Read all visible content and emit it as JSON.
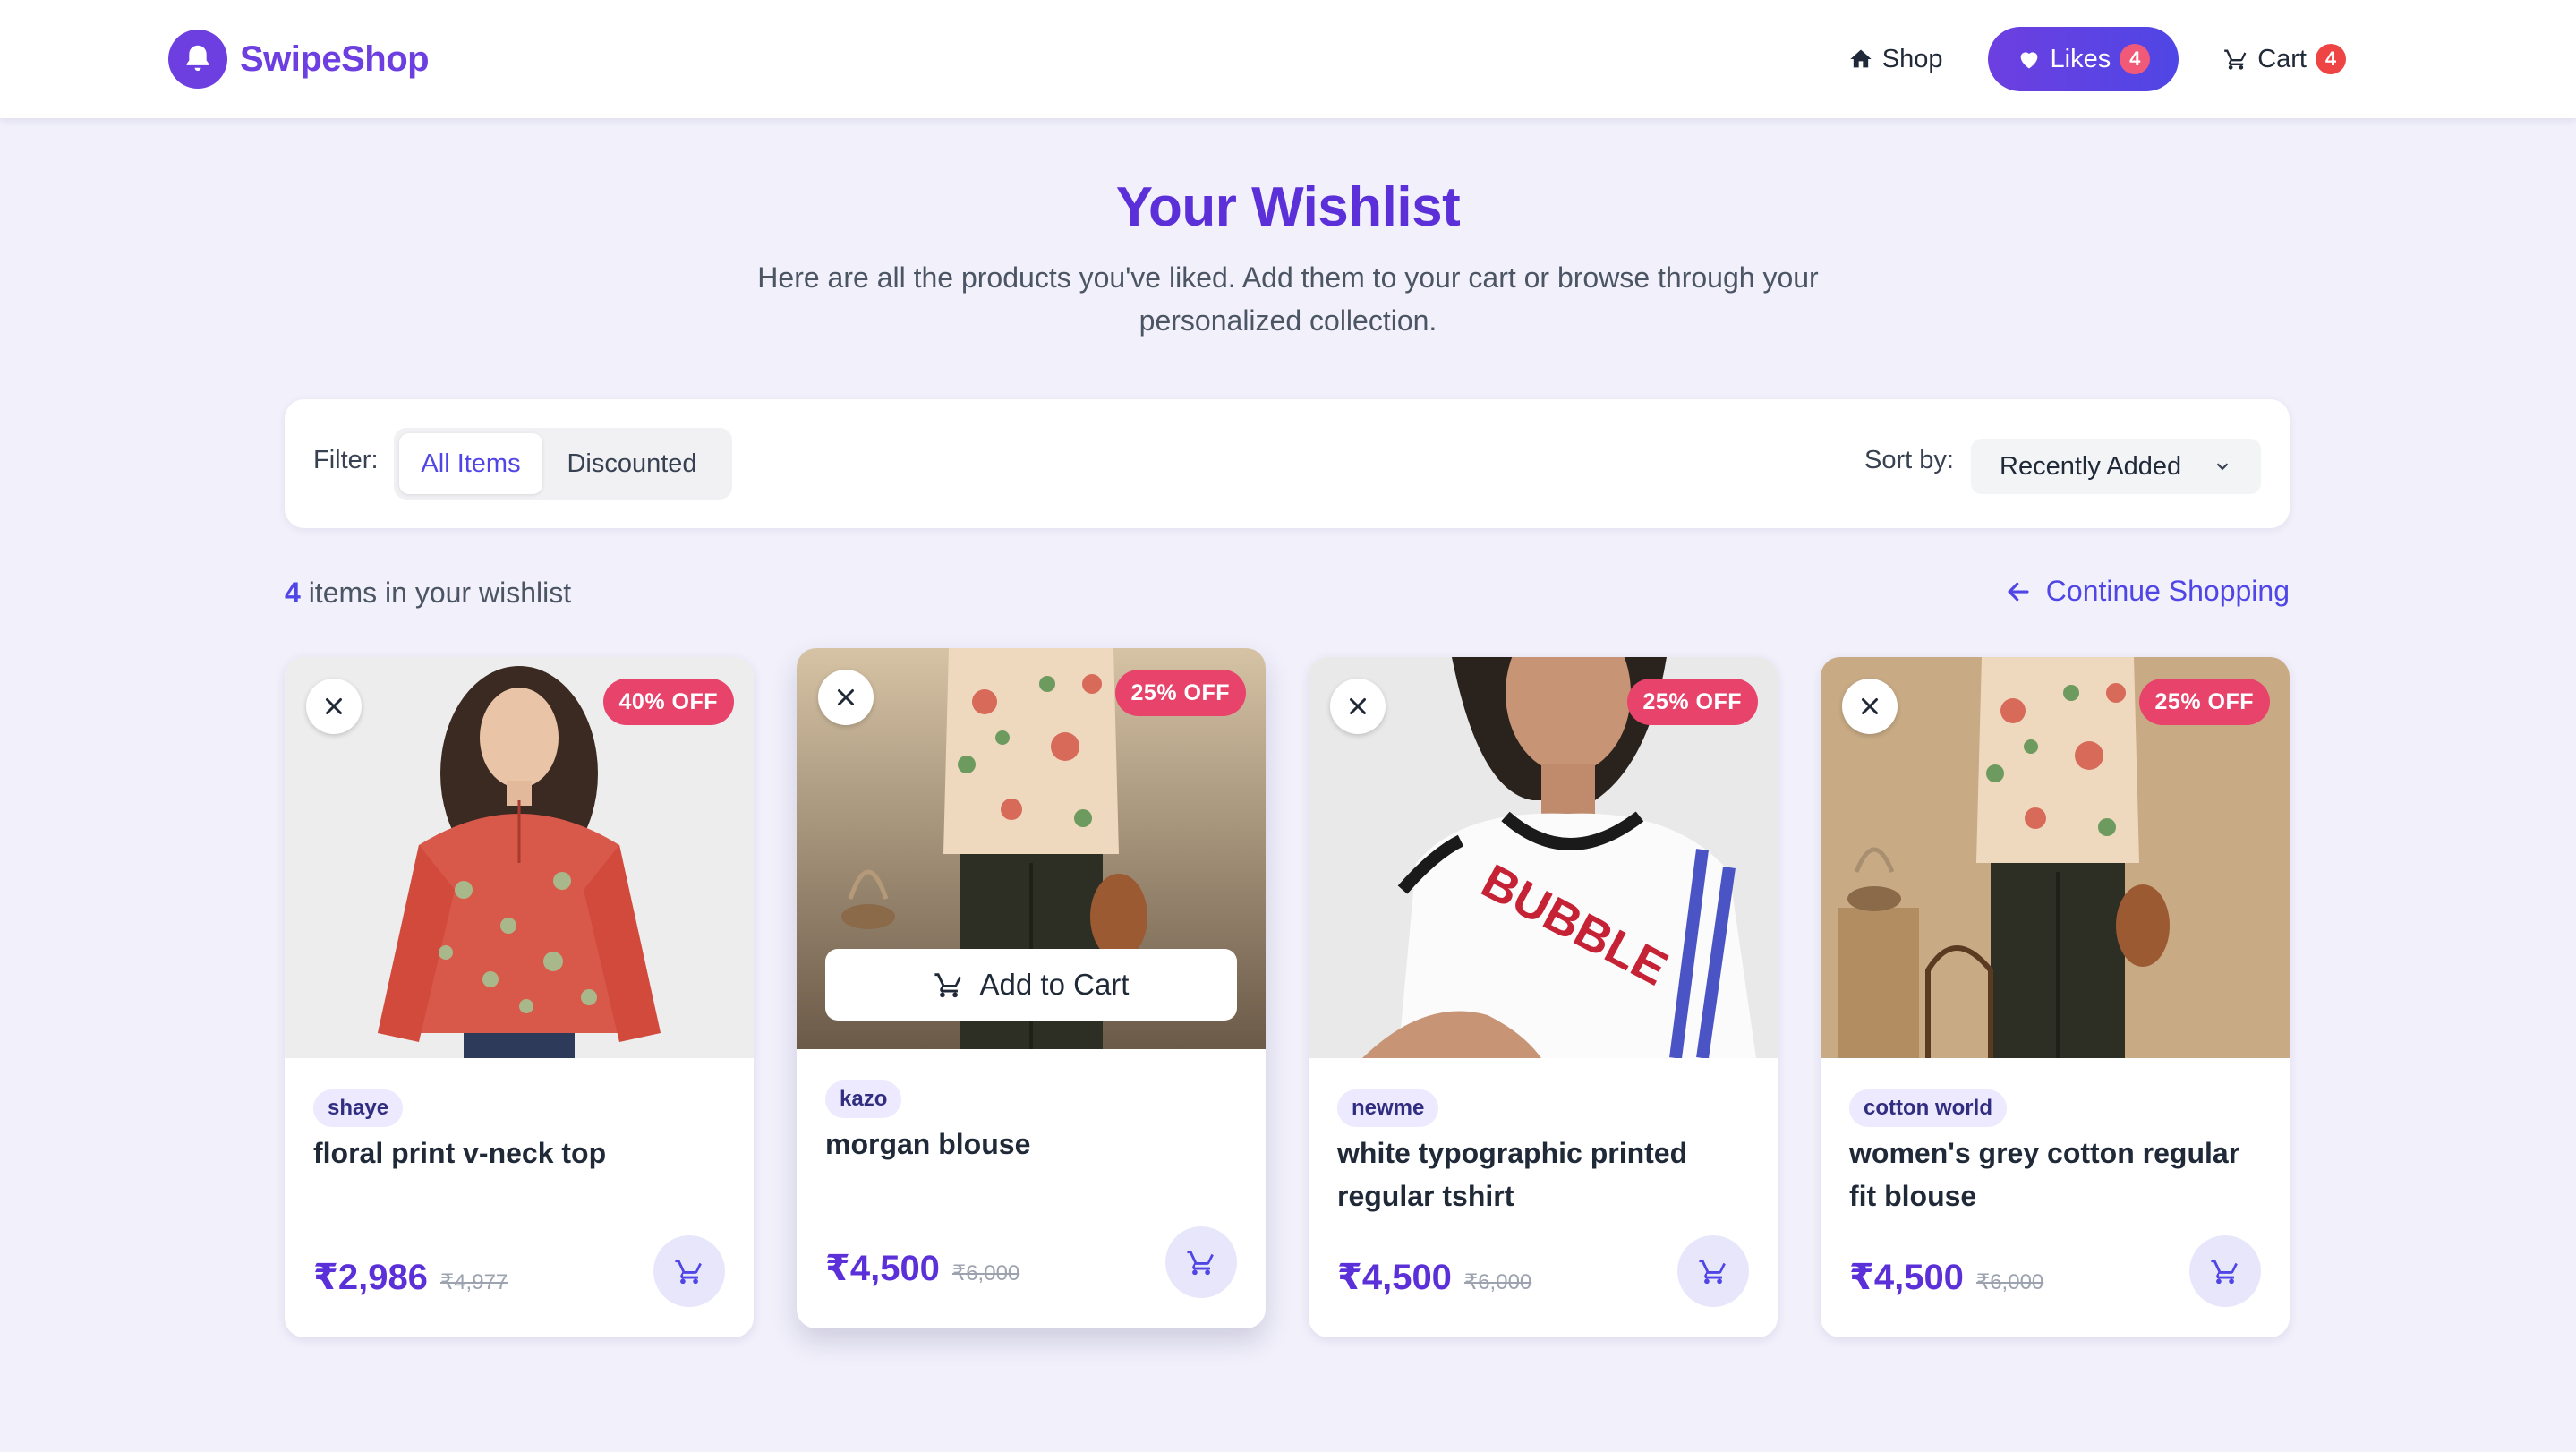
{
  "app": {
    "name": "SwipeShop",
    "logo_icon": "bell-icon",
    "brand_color": "#6d3fe0",
    "accent_color": "#4f46e5"
  },
  "nav": {
    "shop": {
      "label": "Shop",
      "icon": "home-icon"
    },
    "likes": {
      "label": "Likes",
      "count": "4",
      "icon": "heart-icon"
    },
    "cart": {
      "label": "Cart",
      "count": "4",
      "icon": "cart-icon"
    }
  },
  "hero": {
    "title": "Your Wishlist",
    "subtitle": "Here are all the products you've liked. Add them to your cart or browse through your personalized collection."
  },
  "filters": {
    "label": "Filter:",
    "options": [
      "All Items",
      "Discounted"
    ],
    "active": "All Items",
    "sort_label": "Sort by:",
    "sort_value": "Recently Added"
  },
  "summary": {
    "count": "4",
    "text": "items in your wishlist",
    "continue_label": "Continue Shopping"
  },
  "products": [
    {
      "brand": "shaye",
      "title": "floral print v-neck top",
      "price": "₹2,986",
      "old_price": "₹4,977",
      "discount": "40% OFF"
    },
    {
      "brand": "kazo",
      "title": "morgan blouse",
      "price": "₹4,500",
      "old_price": "₹6,000",
      "discount": "25% OFF",
      "hover_action": "Add to Cart"
    },
    {
      "brand": "newme",
      "title": "white typographic printed regular tshirt",
      "price": "₹4,500",
      "old_price": "₹6,000",
      "discount": "25% OFF",
      "print_text": "BUBBLE"
    },
    {
      "brand": "cotton world",
      "title": "women's grey cotton regular fit blouse",
      "price": "₹4,500",
      "old_price": "₹6,000",
      "discount": "25% OFF"
    }
  ]
}
